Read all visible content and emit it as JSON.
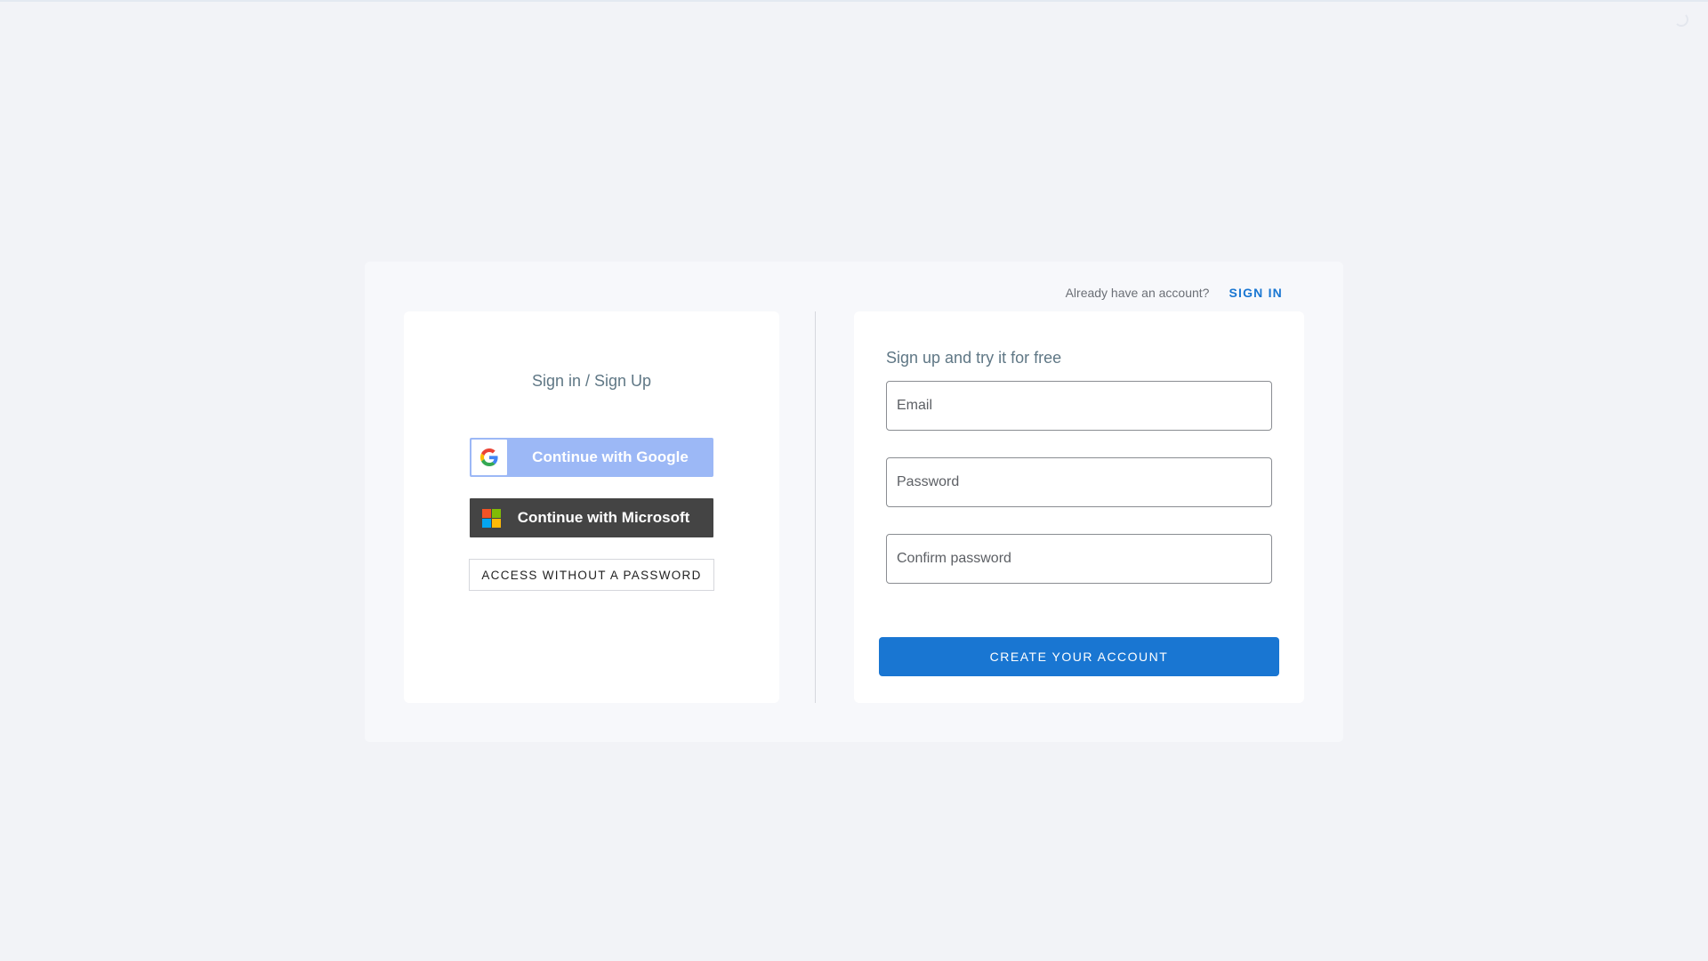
{
  "header": {
    "already_text": "Already have an account?",
    "signin_label": "SIGN IN"
  },
  "left": {
    "title": "Sign in / Sign Up",
    "google_label": "Continue with Google",
    "microsoft_label": "Continue with Microsoft",
    "nopass_label": "ACCESS WITHOUT A PASSWORD"
  },
  "right": {
    "title": "Sign up and try it for free",
    "email_placeholder": "Email",
    "password_placeholder": "Password",
    "confirm_placeholder": "Confirm password",
    "create_label": "CREATE YOUR ACCOUNT"
  },
  "icons": {
    "google": "google-icon",
    "microsoft": "microsoft-icon",
    "spinner": "loading-spinner-icon"
  },
  "colors": {
    "accent": "#1976d2",
    "google_button": "#9cb8f6",
    "microsoft_button": "#444444",
    "ms_red": "#f35325",
    "ms_green": "#81bc06",
    "ms_blue": "#05a6f0",
    "ms_yellow": "#ffba08"
  }
}
